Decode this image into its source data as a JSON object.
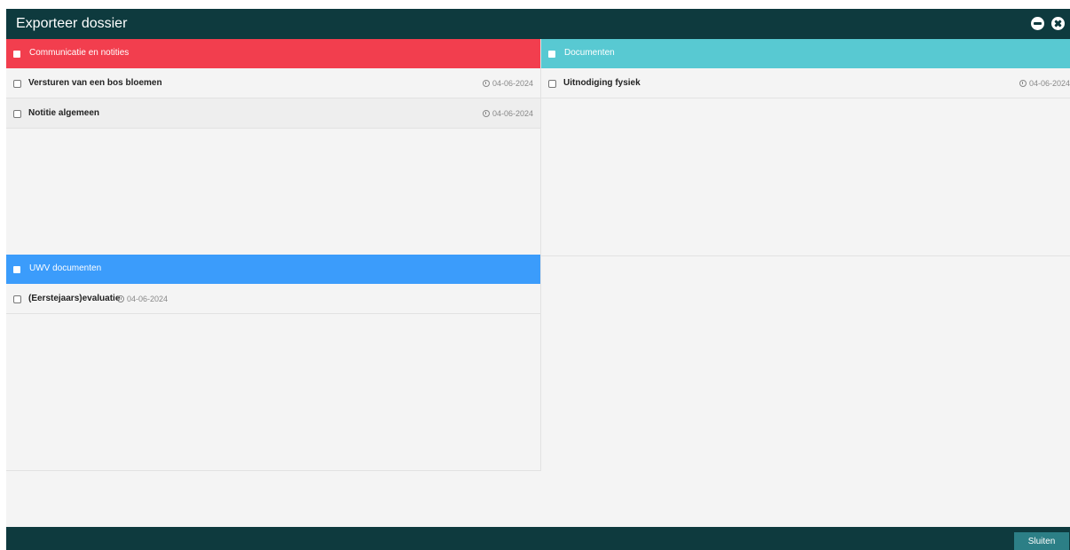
{
  "window": {
    "title": "Exporteer dossier"
  },
  "panels": {
    "communicatie": {
      "title": "Communicatie en notities",
      "color": "#f23e4e",
      "items": [
        {
          "label": "Versturen van een bos bloemen",
          "date": "04-06-2024"
        },
        {
          "label": "Notitie algemeen",
          "date": "04-06-2024"
        }
      ]
    },
    "documenten": {
      "title": "Documenten",
      "color": "#58c9d2",
      "items": [
        {
          "label": "Uitnodiging fysiek",
          "date": "04-06-2024"
        }
      ]
    },
    "uwv": {
      "title": "UWV documenten",
      "color": "#3b9cfb",
      "items": [
        {
          "label": "(Eerstejaars)evaluatie",
          "date": "04-06-2024"
        }
      ]
    }
  },
  "footer": {
    "close_label": "Sluiten",
    "color": "#0e3a3e"
  },
  "icons": {
    "minimize": "minus-circle-icon",
    "close": "times-circle-icon",
    "date": "clock-icon"
  }
}
